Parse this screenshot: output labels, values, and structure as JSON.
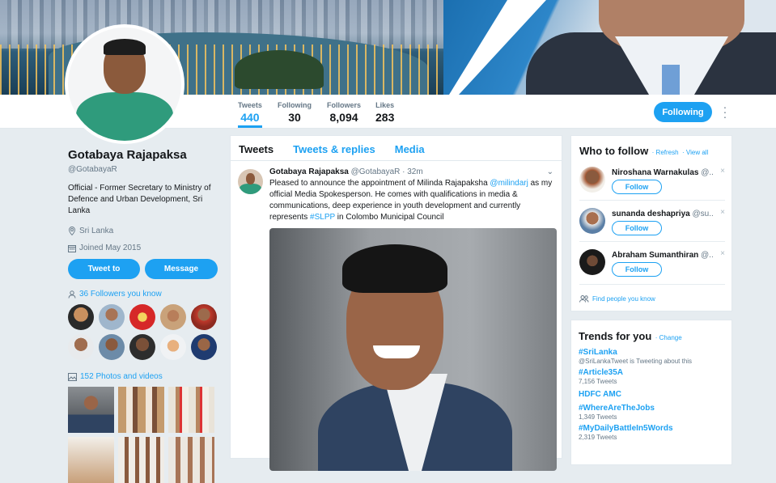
{
  "profile": {
    "name": "Gotabaya Rajapaksa",
    "handle": "@GotabayaR",
    "bio": "Official - Former Secretary to Ministry of Defence and Urban Development, Sri Lanka",
    "location": "Sri Lanka",
    "joined": "Joined May 2015",
    "tweet_to_label": "Tweet to",
    "message_label": "Message",
    "followers_you_know": "36 Followers you know",
    "photos_videos": "152 Photos and videos"
  },
  "stats": [
    {
      "label": "Tweets",
      "value": "440"
    },
    {
      "label": "Following",
      "value": "30"
    },
    {
      "label": "Followers",
      "value": "8,094"
    },
    {
      "label": "Likes",
      "value": "283"
    }
  ],
  "following_button": "Following",
  "timeline": {
    "tabs": [
      "Tweets",
      "Tweets & replies",
      "Media"
    ],
    "tweet": {
      "author": "Gotabaya Rajapaksa",
      "handle": "@GotabayaR",
      "time": "· 32m",
      "text_1": "Pleased to announce the appointment of Milinda Rajapaksha ",
      "mention": "@milindarj",
      "text_2": " as my official Media Spokesperson. He comes with qualifications in media & communications, deep experience in youth development and currently represents ",
      "hashtag": "#SLPP",
      "text_3": " in Colombo Municipal Council"
    }
  },
  "who_to_follow": {
    "title": "Who to follow",
    "refresh": "· Refresh",
    "view_all": "· View all",
    "follow_label": "Follow",
    "find_people": "Find people you know",
    "users": [
      {
        "name": "Niroshana Warnakulas",
        "handle": "@..."
      },
      {
        "name": "sunanda deshapriya",
        "handle": "@su..."
      },
      {
        "name": "Abraham Sumanthiran",
        "handle": "@..."
      }
    ]
  },
  "trends": {
    "title": "Trends for you",
    "change": "· Change",
    "items": [
      {
        "tag": "#SriLanka",
        "count": "@SriLankaTweet is Tweeting about this"
      },
      {
        "tag": "#Article35A",
        "count": "7,156 Tweets"
      },
      {
        "tag": "HDFC AMC",
        "count": ""
      },
      {
        "tag": "#WhereAreTheJobs",
        "count": "1,349 Tweets"
      },
      {
        "tag": "#MyDailyBattleIn5Words",
        "count": "2,319 Tweets"
      }
    ]
  },
  "colors": {
    "accent": "#1da1f2",
    "background": "#e6ecf0",
    "text": "#14171a",
    "muted": "#657786"
  }
}
